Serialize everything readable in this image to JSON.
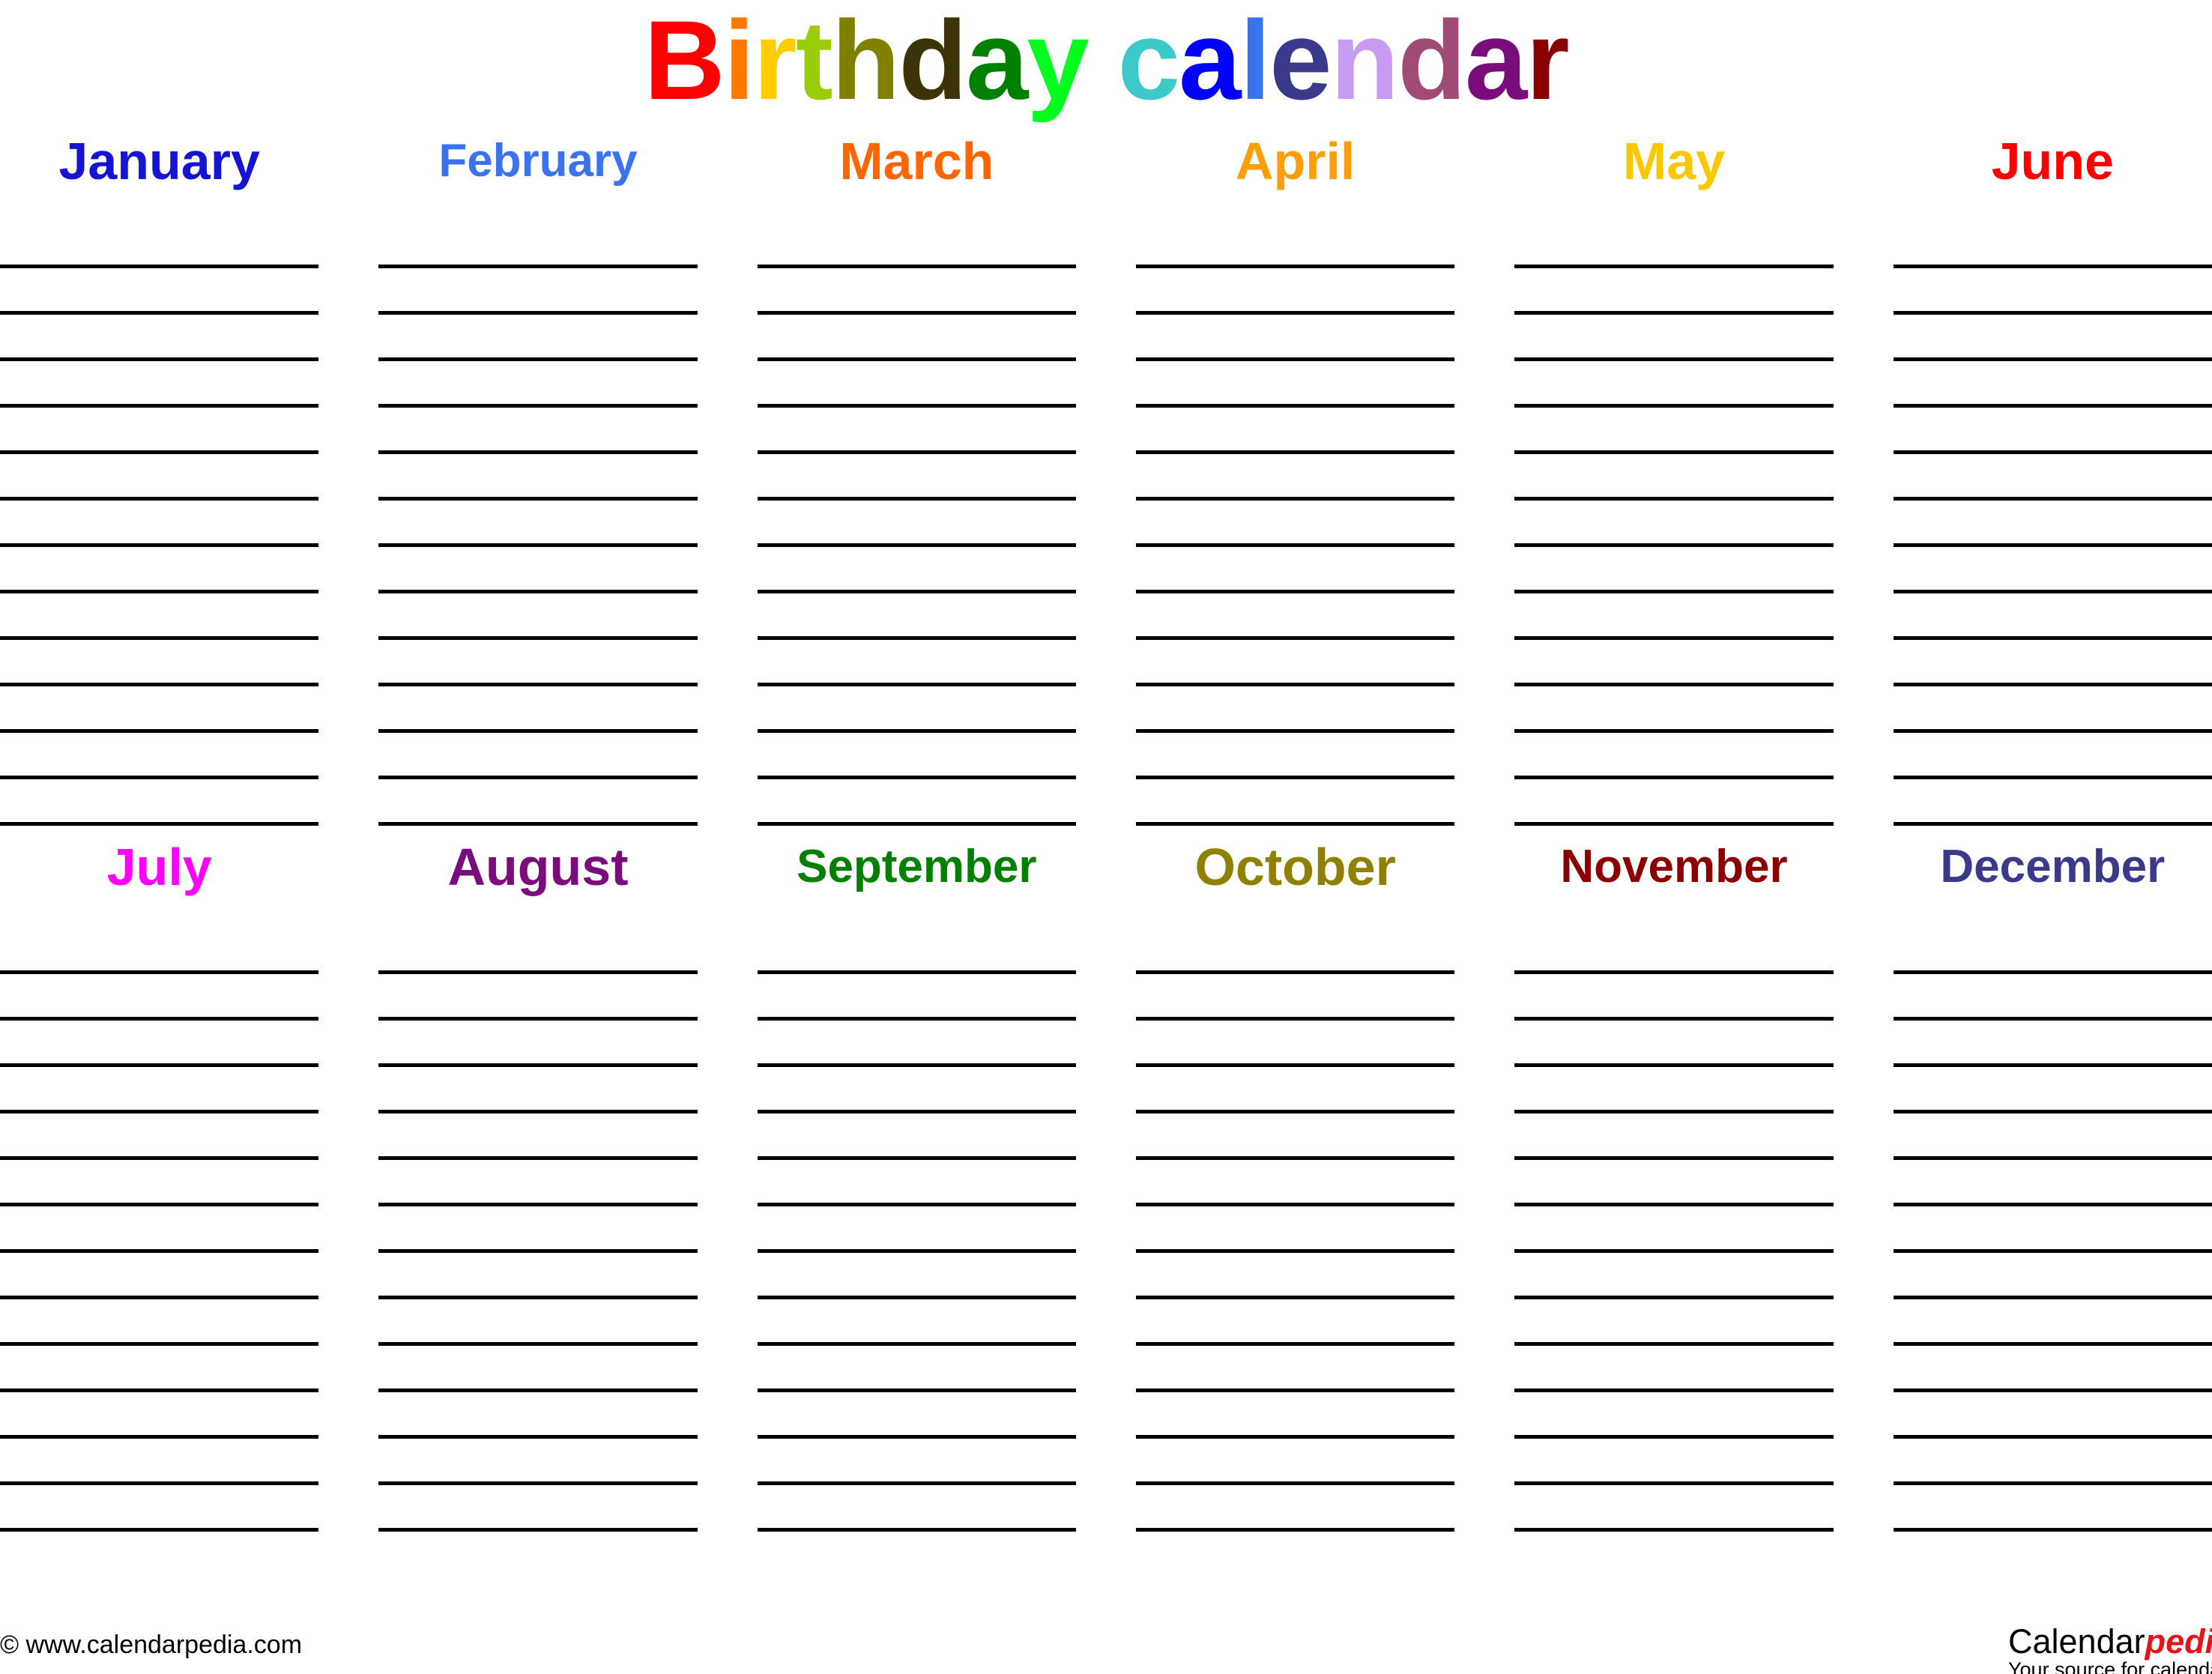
{
  "page": {
    "title_text": "Birthday calendar",
    "background": "#ffffff",
    "line_color": "#000000"
  },
  "title": {
    "letters": [
      {
        "char": "B",
        "color": "#ff0000"
      },
      {
        "char": "i",
        "color": "#ff7800"
      },
      {
        "char": "r",
        "color": "#ffcc00"
      },
      {
        "char": "t",
        "color": "#9acd09"
      },
      {
        "char": "h",
        "color": "#808000"
      },
      {
        "char": "d",
        "color": "#3d3308"
      },
      {
        "char": "a",
        "color": "#008000"
      },
      {
        "char": "y",
        "color": "#00ff1e"
      },
      {
        "char": " ",
        "color": "#ffffff"
      },
      {
        "char": "c",
        "color": "#3dc9ca"
      },
      {
        "char": "a",
        "color": "#0000ff"
      },
      {
        "char": "l",
        "color": "#3973ef"
      },
      {
        "char": "e",
        "color": "#3a3a8c"
      },
      {
        "char": "n",
        "color": "#c79bf2"
      },
      {
        "char": "d",
        "color": "#a04a76"
      },
      {
        "char": "a",
        "color": "#7b0c7b"
      },
      {
        "char": "r",
        "color": "#8b0000"
      }
    ]
  },
  "calendar": {
    "lines_per_month": 13,
    "sections": [
      {
        "name": "first-half",
        "months": [
          {
            "name": "January",
            "color": "#1414d2"
          },
          {
            "name": "February",
            "color": "#3973ef"
          },
          {
            "name": "March",
            "color": "#ff6600"
          },
          {
            "name": "April",
            "color": "#ff9d0a"
          },
          {
            "name": "May",
            "color": "#fac800"
          },
          {
            "name": "June",
            "color": "#ff0000"
          }
        ]
      },
      {
        "name": "second-half",
        "months": [
          {
            "name": "July",
            "color": "#ff00ff"
          },
          {
            "name": "August",
            "color": "#7b0c7b"
          },
          {
            "name": "September",
            "color": "#008000"
          },
          {
            "name": "October",
            "color": "#8f8000"
          },
          {
            "name": "November",
            "color": "#8b0000"
          },
          {
            "name": "December",
            "color": "#3a3a8c"
          }
        ]
      }
    ]
  },
  "footer": {
    "copyright": "© www.calendarpedia.com",
    "logo_primary": "Calendar",
    "logo_accent": "pedia",
    "logo_tagline": "Your source for calendars",
    "accent_color": "#e8121a"
  }
}
